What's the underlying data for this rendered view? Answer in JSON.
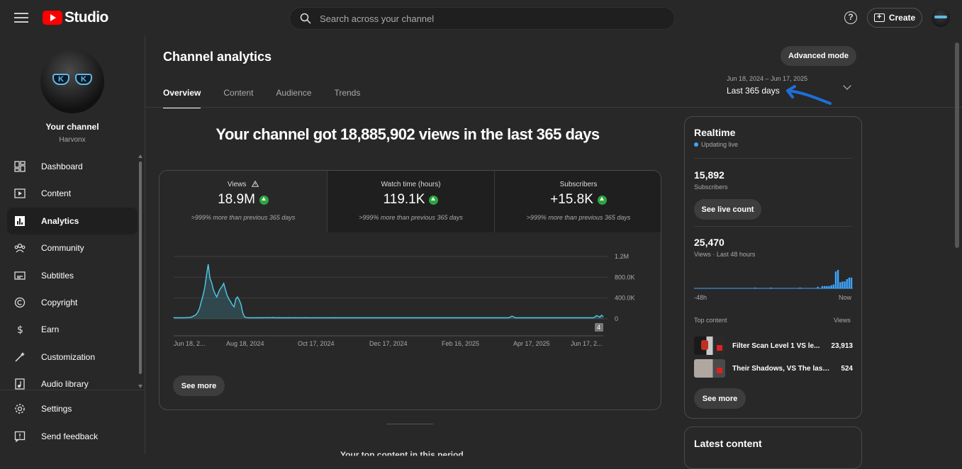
{
  "topbar": {
    "brand": "Studio",
    "search_placeholder": "Search across your channel",
    "create_label": "Create"
  },
  "sidebar": {
    "channel_name": "Your channel",
    "channel_handle": "Harvonx",
    "items": [
      {
        "label": "Dashboard",
        "icon": "dashboard-icon"
      },
      {
        "label": "Content",
        "icon": "content-icon"
      },
      {
        "label": "Analytics",
        "icon": "analytics-icon",
        "active": true
      },
      {
        "label": "Community",
        "icon": "community-icon"
      },
      {
        "label": "Subtitles",
        "icon": "subtitles-icon"
      },
      {
        "label": "Copyright",
        "icon": "copyright-icon"
      },
      {
        "label": "Earn",
        "icon": "earn-icon"
      },
      {
        "label": "Customization",
        "icon": "customization-icon"
      },
      {
        "label": "Audio library",
        "icon": "audio-library-icon"
      }
    ],
    "bottom_items": [
      {
        "label": "Settings",
        "icon": "gear-icon"
      },
      {
        "label": "Send feedback",
        "icon": "feedback-icon"
      }
    ]
  },
  "main": {
    "title": "Channel analytics",
    "advanced_mode": "Advanced mode",
    "tabs": [
      "Overview",
      "Content",
      "Audience",
      "Trends"
    ],
    "date_range": "Jun 18, 2024 – Jun 17, 2025",
    "date_label": "Last 365 days",
    "headline": "Your channel got 18,885,902 views in the last 365 days",
    "metrics": [
      {
        "title": "Views",
        "value": "18.9M",
        "compare": ">999% more than previous 365 days",
        "warning": true
      },
      {
        "title": "Watch time (hours)",
        "value": "119.1K",
        "compare": ">999% more than previous 365 days"
      },
      {
        "title": "Subscribers",
        "value": "+15.8K",
        "compare": ">999% more than previous 365 days"
      }
    ],
    "see_more": "See more",
    "bottom_text": "Your top content in this period",
    "chart_data": {
      "type": "line",
      "series": [
        {
          "values": [
            20000,
            20000,
            20000,
            20000,
            20000,
            20000,
            20000,
            22000,
            24000,
            26000,
            30000,
            45000,
            60000,
            80000,
            130000,
            200000,
            330000,
            450000,
            600000,
            830000,
            1050000,
            780000,
            700000,
            560000,
            480000,
            420000,
            510000,
            580000,
            620000,
            680000,
            560000,
            450000,
            380000,
            330000,
            270000,
            230000,
            380000,
            420000,
            360000,
            280000,
            120000,
            40000,
            25000,
            22000,
            20000,
            20000,
            20000,
            20000,
            20000,
            22000,
            20000,
            20000,
            22000,
            22000,
            20000,
            25000,
            20000,
            22000,
            25000,
            20000,
            20000,
            22000,
            20000,
            22000,
            20000,
            20000,
            20000,
            22000,
            20000,
            20000,
            22000,
            20000,
            20000,
            20000,
            20000,
            20000,
            22000,
            20000,
            20000,
            20000,
            20000,
            20000,
            20000,
            20000,
            20000,
            20000,
            20000,
            20000,
            20000,
            20000,
            20000,
            20000,
            20000,
            22000,
            20000,
            20000,
            20000,
            20000,
            20000,
            20000,
            20000,
            20000,
            20000,
            20000,
            20000,
            20000,
            20000,
            20000,
            20000,
            20000,
            20000,
            20000,
            20000,
            20000,
            20000,
            20000,
            20000,
            20000,
            20000,
            20000,
            20000,
            20000,
            20000,
            20000,
            20000,
            20000,
            20000,
            20000,
            20000,
            20000,
            20000,
            20000,
            20000,
            20000,
            20000,
            20000,
            20000,
            20000,
            20000,
            20000,
            20000,
            20000,
            20000,
            20000,
            20000,
            20000,
            20000,
            20000,
            20000,
            20000,
            20000,
            20000,
            20000,
            20000,
            20000,
            20000,
            20000,
            20000,
            20000,
            20000,
            20000,
            20000,
            20000,
            20000,
            20000,
            20000,
            20000,
            20000,
            20000,
            20000,
            20000,
            20000,
            20000,
            20000,
            20000,
            20000,
            20000,
            20000,
            20000,
            20000,
            20000,
            20000,
            20000,
            20000,
            20000,
            20000,
            20000,
            20000,
            20000,
            20000,
            20000,
            20000,
            20000,
            20000,
            20000,
            30000,
            50000,
            40000,
            20000,
            20000,
            20000,
            20000,
            20000,
            20000,
            20000,
            20000,
            20000,
            20000,
            20000,
            20000,
            20000,
            20000,
            20000,
            20000,
            20000,
            20000,
            20000,
            20000,
            20000,
            20000,
            20000,
            20000,
            20000,
            20000,
            20000,
            20000,
            20000,
            20000,
            20000,
            20000,
            20000,
            20000,
            20000,
            20000,
            20000,
            20000,
            20000,
            20000,
            20000,
            20000,
            20000,
            20000,
            20000,
            20000,
            30000,
            60000,
            50000,
            30000,
            70000,
            40000
          ]
        }
      ],
      "x_ticks": [
        "Jun 18, 2...",
        "Aug 18, 2024",
        "Oct 17, 2024",
        "Dec 17, 2024",
        "Feb 16, 2025",
        "Apr 17, 2025",
        "Jun 17, 2..."
      ],
      "y_ticks": [
        "1.2M",
        "800.0K",
        "400.0K",
        "0"
      ],
      "ylim": [
        0,
        1200000
      ],
      "marker_label": "4",
      "color": "#4fc3e0"
    }
  },
  "realtime": {
    "title": "Realtime",
    "status": "Updating live",
    "subscribers": "15,892",
    "subscribers_label": "Subscribers",
    "live_count_btn": "See live count",
    "views": "25,470",
    "views_label": "Views · Last 48 hours",
    "axis_left": "-48h",
    "axis_right": "Now",
    "top_content_label": "Top content",
    "views_col": "Views",
    "rows": [
      {
        "title": "Filter Scan Level 1 VS le...",
        "views": "23,913"
      },
      {
        "title": "Their Shadows, VS The last...",
        "views": "524"
      }
    ],
    "see_more": "See more",
    "bars": [
      0,
      0,
      0,
      0,
      0,
      0,
      0,
      0,
      0,
      0,
      0,
      0,
      0,
      0,
      0,
      0,
      0,
      0,
      0,
      0,
      0,
      0,
      0,
      0,
      0,
      0,
      0,
      1,
      0,
      0,
      0,
      0,
      0,
      0,
      1,
      0,
      0,
      0,
      0,
      0,
      0,
      0,
      0,
      0,
      0,
      0,
      0,
      1,
      0,
      0,
      0,
      0,
      0,
      0,
      0,
      2,
      0,
      3,
      3,
      3,
      3,
      4,
      5,
      22,
      24,
      8,
      9,
      9,
      12,
      14,
      14
    ]
  },
  "latest": {
    "title": "Latest content"
  }
}
